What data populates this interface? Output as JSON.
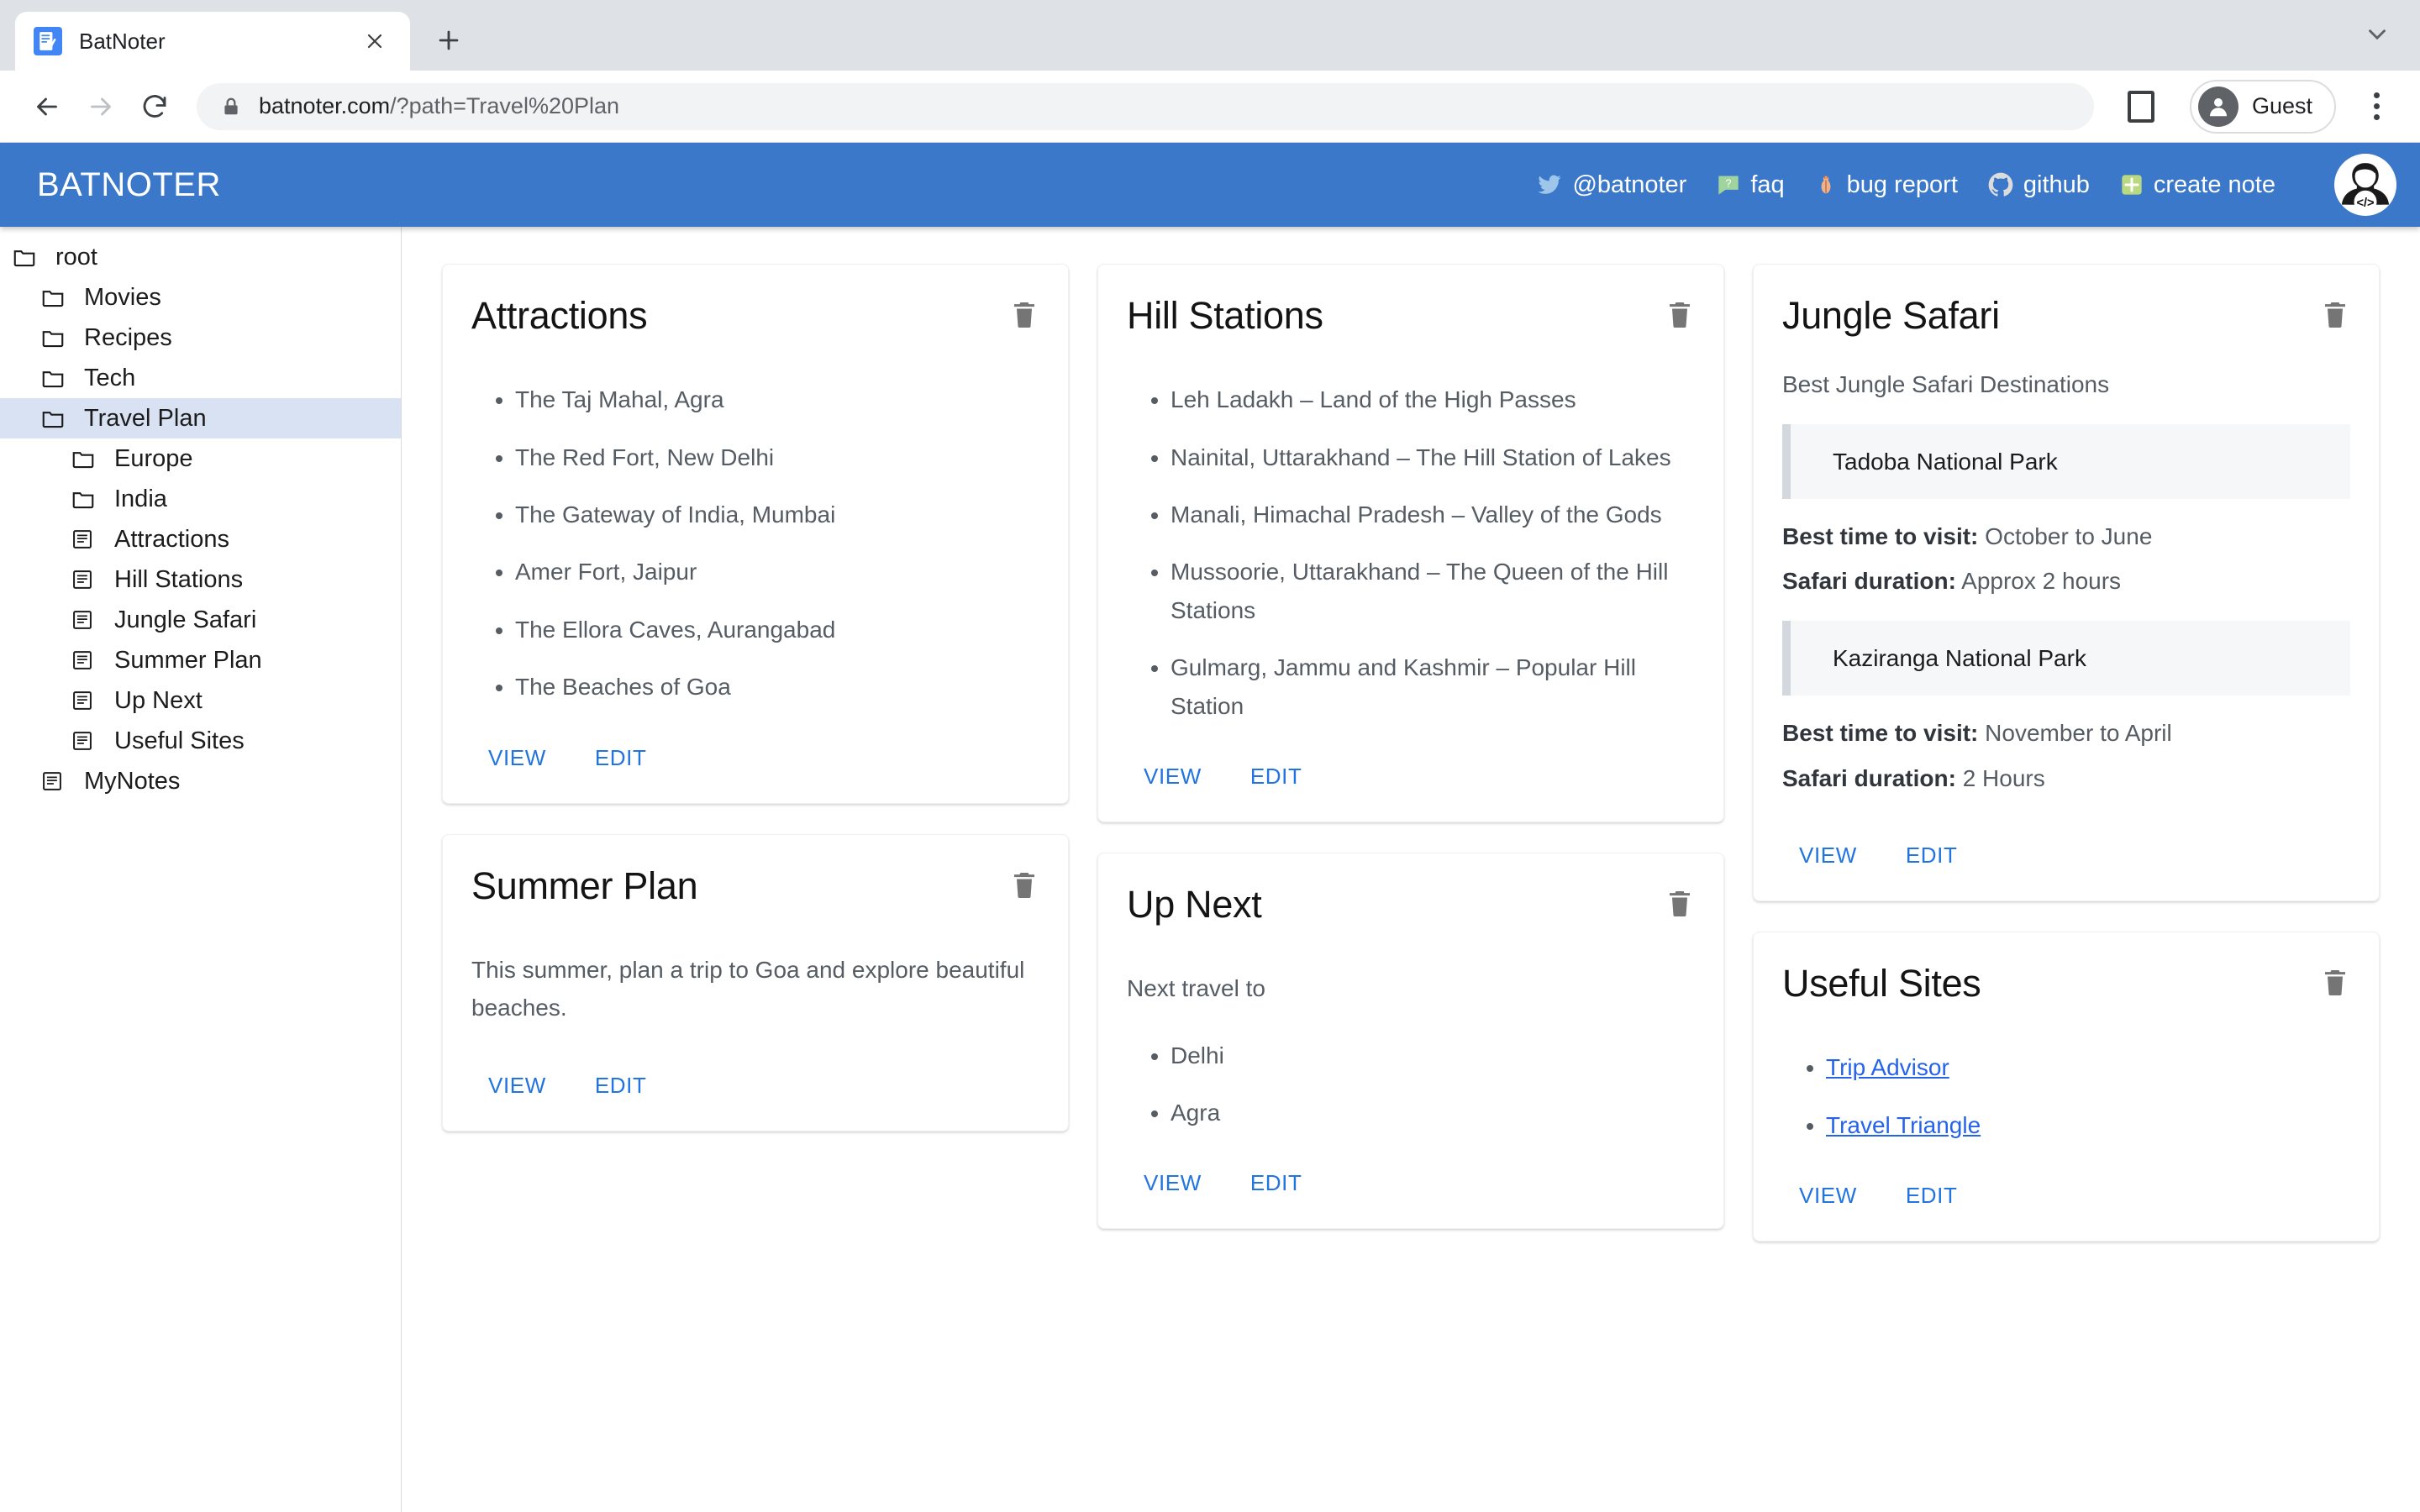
{
  "browser": {
    "tab": {
      "title": "BatNoter",
      "favicon_icon": "note-favicon",
      "close_icon": "close-icon"
    },
    "new_tab_label": "+",
    "tabstrip_menu_icon": "chevron-down-icon",
    "back_icon": "back-arrow-icon",
    "forward_icon": "forward-arrow-icon",
    "reload_icon": "reload-icon",
    "lock_icon": "lock-icon",
    "url_domain": "batnoter.com",
    "url_path": "/?path=Travel%20Plan",
    "split_icon": "split-view-icon",
    "profile_name": "Guest",
    "profile_icon": "person-icon",
    "menu_icon": "kebab-menu-icon"
  },
  "appbar": {
    "brand": "BATNOTER",
    "links": [
      {
        "label": "@batnoter",
        "icon": "twitter-icon"
      },
      {
        "label": "faq",
        "icon": "faq-icon"
      },
      {
        "label": "bug report",
        "icon": "bug-icon"
      },
      {
        "label": "github",
        "icon": "github-icon"
      },
      {
        "label": "create note",
        "icon": "plus-square-icon"
      }
    ],
    "avatar_icon": "developer-avatar-icon",
    "accent_color": "#3b78c9"
  },
  "sidebar": {
    "items": [
      {
        "label": "root",
        "type": "folder",
        "level": 0,
        "selected": false
      },
      {
        "label": "Movies",
        "type": "folder",
        "level": 1,
        "selected": false
      },
      {
        "label": "Recipes",
        "type": "folder",
        "level": 1,
        "selected": false
      },
      {
        "label": "Tech",
        "type": "folder",
        "level": 1,
        "selected": false
      },
      {
        "label": "Travel Plan",
        "type": "folder",
        "level": 1,
        "selected": true
      },
      {
        "label": "Europe",
        "type": "folder",
        "level": 2,
        "selected": false
      },
      {
        "label": "India",
        "type": "folder",
        "level": 2,
        "selected": false
      },
      {
        "label": "Attractions",
        "type": "note",
        "level": 2,
        "selected": false
      },
      {
        "label": "Hill Stations",
        "type": "note",
        "level": 2,
        "selected": false
      },
      {
        "label": "Jungle Safari",
        "type": "note",
        "level": 2,
        "selected": false
      },
      {
        "label": "Summer Plan",
        "type": "note",
        "level": 2,
        "selected": false
      },
      {
        "label": "Up Next",
        "type": "note",
        "level": 2,
        "selected": false
      },
      {
        "label": "Useful Sites",
        "type": "note",
        "level": 2,
        "selected": false
      },
      {
        "label": "MyNotes",
        "type": "note",
        "level": 1,
        "selected": false
      }
    ],
    "selected_bg": "#d9e2f3"
  },
  "card_actions": {
    "view_label": "VIEW",
    "edit_label": "EDIT",
    "delete_icon": "trash-icon",
    "link_color": "#2274e0"
  },
  "columns": [
    {
      "cards": [
        {
          "title": "Attractions",
          "body_type": "list",
          "items": [
            "The Taj Mahal, Agra",
            "The Red Fort, New Delhi",
            "The Gateway of India, Mumbai",
            "Amer Fort, Jaipur",
            "The Ellora Caves, Aurangabad",
            "The Beaches of Goa"
          ]
        },
        {
          "title": "Summer Plan",
          "body_type": "paragraph",
          "paragraph": "This summer, plan a trip to Goa and explore beautiful beaches."
        }
      ]
    },
    {
      "cards": [
        {
          "title": "Hill Stations",
          "body_type": "list",
          "items": [
            "Leh Ladakh – Land of the High Passes",
            "Nainital, Uttarakhand – The Hill Station of Lakes",
            "Manali, Himachal Pradesh – Valley of the Gods",
            "Mussoorie, Uttarakhand – The Queen of the Hill Stations",
            "Gulmarg, Jammu and Kashmir – Popular Hill Station"
          ]
        },
        {
          "title": "Up Next",
          "body_type": "lead_list",
          "lead": "Next travel to",
          "items": [
            "Delhi",
            "Agra"
          ]
        }
      ]
    },
    {
      "cards": [
        {
          "title": "Jungle Safari",
          "body_type": "safari",
          "lead": "Best Jungle Safari Destinations",
          "entries": [
            {
              "park": "Tadoba National Park",
              "best_time_label": "Best time to visit:",
              "best_time_value": "October to June",
              "duration_label": "Safari duration:",
              "duration_value": "Approx 2 hours"
            },
            {
              "park": "Kaziranga National Park",
              "best_time_label": "Best time to visit:",
              "best_time_value": "November to April",
              "duration_label": "Safari duration:",
              "duration_value": "2 Hours"
            }
          ]
        },
        {
          "title": "Useful Sites",
          "body_type": "link_list",
          "items": [
            "Trip Advisor",
            "Travel Triangle"
          ]
        }
      ]
    }
  ]
}
